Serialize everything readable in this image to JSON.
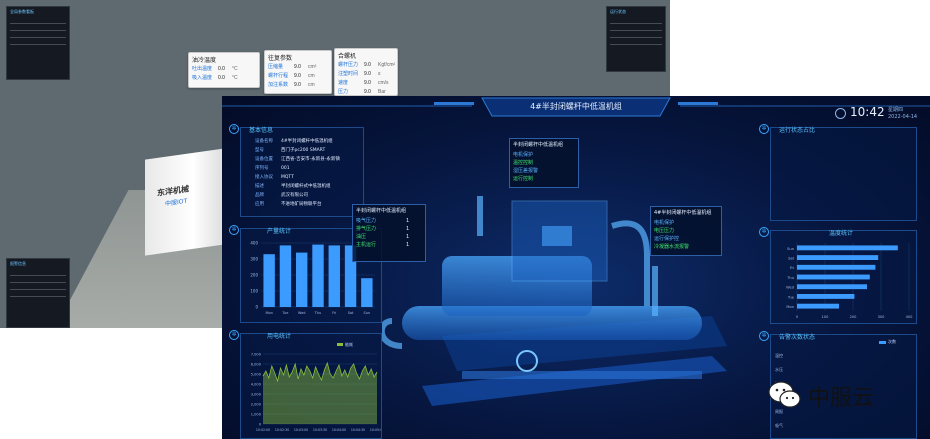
{
  "scene": {
    "left_panel": {
      "title": "全局参数看板"
    },
    "bottom_left_panel": {
      "title": "报警信息"
    },
    "top_right_panel": {
      "title": "运行状态"
    },
    "cards": [
      {
        "title": "油冷温度",
        "rows": [
          {
            "name": "吐出温度",
            "value": "0.0",
            "unit": "°C"
          },
          {
            "name": "吸入温度",
            "value": "0.0",
            "unit": "°C"
          }
        ]
      },
      {
        "title": "往复参数",
        "rows": [
          {
            "name": "压缩量",
            "value": "9.0",
            "unit": "cm³"
          },
          {
            "name": "螺杆行程",
            "value": "9.0",
            "unit": "cm"
          },
          {
            "name": "加注系数",
            "value": "9.0",
            "unit": "cm"
          }
        ]
      },
      {
        "title": "合螺机",
        "rows": [
          {
            "name": "螺杆压力",
            "value": "9.0",
            "unit": "Kgf/cm²"
          },
          {
            "name": "注塑时间",
            "value": "9.0",
            "unit": "s"
          },
          {
            "name": "速度",
            "value": "9.0",
            "unit": "cm/s"
          },
          {
            "name": "压力",
            "value": "9.0",
            "unit": "Bar"
          }
        ]
      }
    ],
    "machine_label": {
      "line1": "东洋机械",
      "line2": "中服IOT"
    }
  },
  "dash": {
    "title": "4#半封闭螺杆中低温机组",
    "time": "10:42",
    "weekday": "星期四",
    "date": "2022-04-14",
    "basic_info": {
      "title": "基本信息",
      "rows": [
        {
          "k": "设备名称",
          "v": "4#半封闭螺杆中低温机组"
        },
        {
          "k": "型号",
          "v": "西门子pc200 SMART"
        },
        {
          "k": "设备位置",
          "v": "江西省-吉安市-永新县-永新镇"
        },
        {
          "k": "序列号",
          "v": "001"
        },
        {
          "k": "接入协议",
          "v": "MQTT"
        },
        {
          "k": "描述",
          "v": "半封闭螺杆式中低温机组"
        },
        {
          "k": "品牌",
          "v": "武汉有限公司"
        },
        {
          "k": "应用",
          "v": "不进地矿局物联平台"
        }
      ]
    },
    "production": {
      "title": "产量统计",
      "chart_data": {
        "type": "bar",
        "categories": [
          "Mon",
          "Tue",
          "Wed",
          "Thu",
          "Fri",
          "Sat",
          "Sun"
        ],
        "values": [
          330,
          385,
          340,
          390,
          385,
          385,
          180
        ],
        "ylim": [
          0,
          400
        ],
        "yticks": [
          "0",
          "100",
          "200",
          "300",
          "400"
        ]
      }
    },
    "energy": {
      "title": "用电统计",
      "legend": "能耗",
      "chart_data": {
        "type": "area",
        "yticks": [
          "0",
          "1,000",
          "2,000",
          "3,000",
          "4,000",
          "5,000",
          "6,000",
          "7,000"
        ],
        "ylim": [
          0,
          7000
        ],
        "xticks": [
          "10:02:00",
          "10:02:30",
          "10:03:00",
          "10:03:30",
          "10:04:00",
          "10:04:30",
          "10:05:00"
        ],
        "values": [
          4800,
          5300,
          4600,
          5800,
          5100,
          4300,
          5600,
          4900,
          5900,
          4700,
          5200,
          6000,
          4500,
          5500,
          4900,
          5800,
          5300,
          4600,
          5700,
          5000,
          4400,
          5400,
          6100,
          5000,
          4600,
          5300,
          5900,
          4800,
          5400,
          4700,
          5600,
          6000,
          5100,
          4500,
          5300,
          5800,
          4900,
          5500,
          4700,
          5200
        ]
      }
    },
    "status_card": {
      "title": "半封闭螺杆中低温机组",
      "items": [
        {
          "label": "吸气压力",
          "value": "1"
        },
        {
          "label": "排气压力",
          "value": "1"
        },
        {
          "label": "油压",
          "value": "1"
        },
        {
          "label": "主机运行",
          "value": "1"
        }
      ]
    },
    "mid_card": {
      "title": "半封闭螺杆中低温机组",
      "items": [
        "电机保护",
        "温控控制",
        "湿压差报警",
        "运行控制"
      ]
    },
    "right_card": {
      "title": "4#半封闭螺杆中低温机组",
      "items": [
        "电机保护",
        "电压压力",
        "运行保护控",
        "冷凝器水流报警"
      ]
    },
    "right_top": {
      "title": "运行状态占比"
    },
    "right_mid": {
      "title": "温度统计",
      "chart_data": {
        "type": "bar",
        "orientation": "horizontal",
        "categories": [
          "Sun",
          "Sat",
          "Fri",
          "Thu",
          "Wed",
          "Tue",
          "Mon"
        ],
        "values": [
          360,
          290,
          280,
          260,
          250,
          205,
          150
        ],
        "xlim": [
          0,
          400
        ],
        "xticks": [
          "0",
          "100",
          "200",
          "300",
          "400"
        ]
      }
    },
    "right_bottom": {
      "title": "告警次数状态",
      "legend": "次数",
      "categories": [
        "温控",
        "水压",
        "油温",
        "排气",
        "周报",
        "吸气"
      ]
    }
  },
  "watermark": {
    "text": "中服云"
  },
  "colors": {
    "accent": "#3aa6ff",
    "bar": "#3c9bff",
    "panel_border": "#1c4a8a",
    "area": "#8bbf3a"
  }
}
